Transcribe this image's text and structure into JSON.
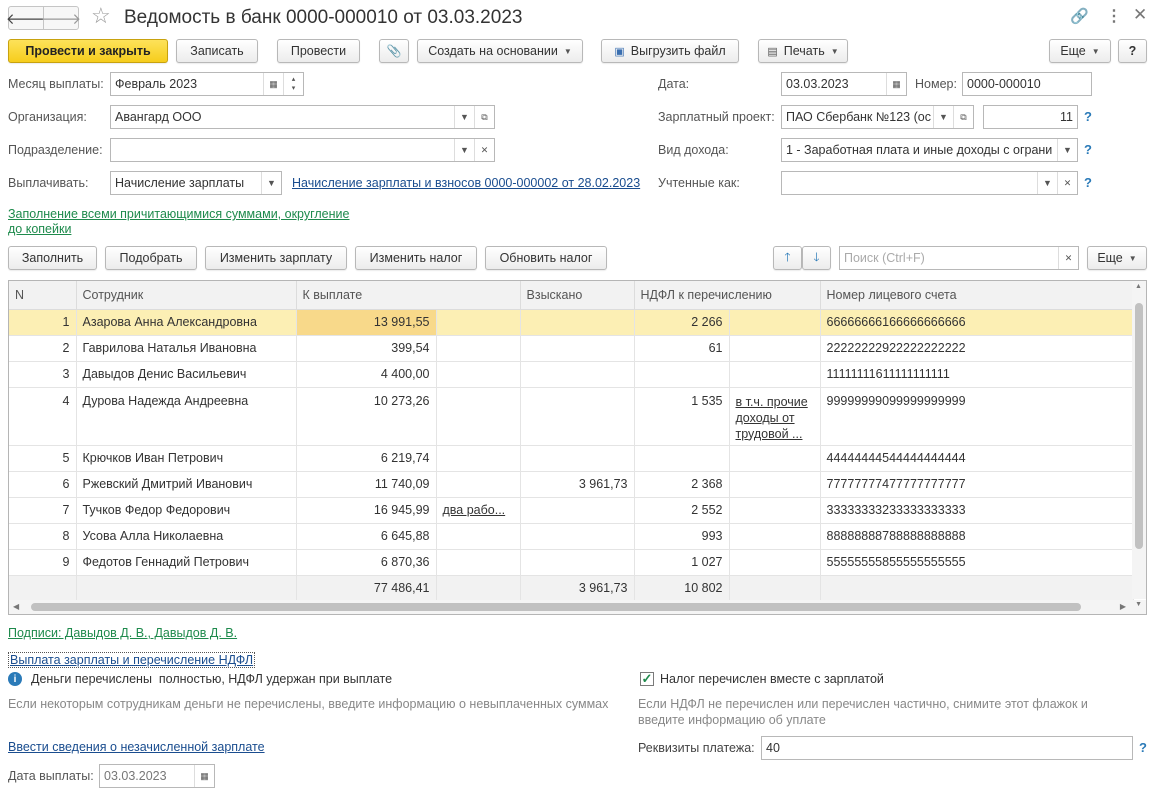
{
  "window": {
    "title": "Ведомость в банк 0000-000010 от 03.03.2023"
  },
  "toolbar": {
    "post_close": "Провести и закрыть",
    "save": "Записать",
    "post": "Провести",
    "create_based": "Создать на основании",
    "export_file": "Выгрузить файл",
    "print": "Печать",
    "more": "Еще",
    "help": "?"
  },
  "form": {
    "month_label": "Месяц выплаты:",
    "month_value": "Февраль 2023",
    "org_label": "Организация:",
    "org_value": "Авангард ООО",
    "dept_label": "Подразделение:",
    "dept_value": "",
    "pay_label": "Выплачивать:",
    "pay_value": "Начисление зарплаты",
    "pay_doc_link": "Начисление зарплаты и взносов 0000-000002 от 28.02.2023",
    "date_label": "Дата:",
    "date_value": "03.03.2023",
    "number_label": "Номер:",
    "number_value": "0000-000010",
    "project_label": "Зарплатный проект:",
    "project_value": "ПАО Сбербанк №123 (ос",
    "project_count": "11",
    "income_label": "Вид дохода:",
    "income_value": "1 - Заработная плата и иные доходы с ограни",
    "counted_label": "Учтенные как:",
    "counted_value": "",
    "fill_link_1": "Заполнение всеми причитающимися суммами, округление",
    "fill_link_2": "до копейки"
  },
  "table_toolbar": {
    "fill": "Заполнить",
    "pick": "Подобрать",
    "change_salary": "Изменить зарплату",
    "change_tax": "Изменить налог",
    "refresh_tax": "Обновить налог",
    "search_placeholder": "Поиск (Ctrl+F)",
    "more": "Еще"
  },
  "table": {
    "columns": [
      "N",
      "Сотрудник",
      "К выплате",
      "",
      "Взыскано",
      "НДФЛ к перечислению",
      "",
      "Номер лицевого счета"
    ],
    "rows": [
      {
        "n": "1",
        "name": "Азарова Анна Александровна",
        "pay": "13 991,55",
        "pay_note": "",
        "withheld": "",
        "ndfl": "2 266",
        "ndfl_note": "",
        "account": "66666666166666666666"
      },
      {
        "n": "2",
        "name": "Гаврилова Наталья Ивановна",
        "pay": "399,54",
        "pay_note": "",
        "withheld": "",
        "ndfl": "61",
        "ndfl_note": "",
        "account": "22222222922222222222"
      },
      {
        "n": "3",
        "name": "Давыдов Денис Васильевич",
        "pay": "4 400,00",
        "pay_note": "",
        "withheld": "",
        "ndfl": "",
        "ndfl_note": "",
        "account": "11111111611111111111"
      },
      {
        "n": "4",
        "name": "Дурова Надежда Андреевна",
        "pay": "10 273,26",
        "pay_note": "",
        "withheld": "",
        "ndfl": "1 535",
        "ndfl_note": "в т.ч. прочие доходы от трудовой ...",
        "account": "99999999099999999999"
      },
      {
        "n": "5",
        "name": "Крючков Иван Петрович",
        "pay": "6 219,74",
        "pay_note": "",
        "withheld": "",
        "ndfl": "",
        "ndfl_note": "",
        "account": "44444444544444444444"
      },
      {
        "n": "6",
        "name": "Ржевский Дмитрий Иванович",
        "pay": "11 740,09",
        "pay_note": "",
        "withheld": "3 961,73",
        "ndfl": "2 368",
        "ndfl_note": "",
        "account": "77777777477777777777"
      },
      {
        "n": "7",
        "name": "Тучков Федор Федорович",
        "pay": "16 945,99",
        "pay_note": "два рабо...",
        "withheld": "",
        "ndfl": "2 552",
        "ndfl_note": "",
        "account": "33333333233333333333"
      },
      {
        "n": "8",
        "name": "Усова Алла Николаевна",
        "pay": "6 645,88",
        "pay_note": "",
        "withheld": "",
        "ndfl": "993",
        "ndfl_note": "",
        "account": "88888888788888888888"
      },
      {
        "n": "9",
        "name": "Федотов Геннадий Петрович",
        "pay": "6 870,36",
        "pay_note": "",
        "withheld": "",
        "ndfl": "1 027",
        "ndfl_note": "",
        "account": "55555555855555555555"
      }
    ],
    "totals": {
      "pay": "77 486,41",
      "withheld": "3 961,73",
      "ndfl": "10 802"
    }
  },
  "bottom": {
    "signatures": "Подписи: Давыдов Д. В., Давыдов Д. В.",
    "payment_link": "Выплата зарплаты и перечисление НДФЛ",
    "info_text": "Деньги перечислены  полностью, НДФЛ удержан при выплате",
    "info_hint": "Если некоторым сотрудникам деньги не перечислены, введите информацию о невыплаченных суммах",
    "tax_checkbox_label": "Налог перечислен вместе с зарплатой",
    "tax_hint_1": "Если НДФЛ не перечислен или перечислен частично, снимите этот флажок и",
    "tax_hint_2": "введите информацию об уплате",
    "unaccrued_link": "Ввести сведения о незачисленной зарплате",
    "pay_details_label": "Реквизиты платежа:",
    "pay_details_value": "40",
    "pay_date_label": "Дата выплаты:",
    "pay_date_value": "03.03.2023"
  }
}
